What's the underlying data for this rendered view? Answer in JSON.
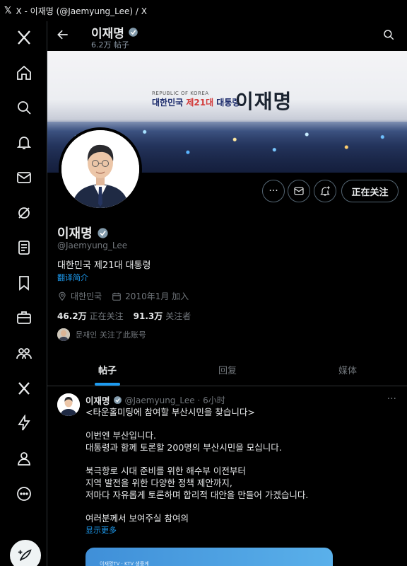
{
  "window": {
    "title": "X - 이재명 (@Jaemyung_Lee) / X",
    "app_glyph": "𝕏"
  },
  "nav": {
    "items": [
      "home",
      "explore",
      "notifications",
      "messages",
      "grok",
      "lists",
      "bookmarks",
      "jobs",
      "communities",
      "premium",
      "verified-orgs",
      "profile",
      "more"
    ]
  },
  "header": {
    "name": "이재명",
    "posts_count": "6.2万 帖子"
  },
  "banner": {
    "small_text": "REPUBLIC OF KOREA",
    "subtitle_prefix": "대한민국 ",
    "subtitle_accent": "제21대",
    "subtitle_suffix": " 대통령",
    "big_text": "이재명"
  },
  "actions": {
    "follow_label": "正在关注",
    "more_label": "···"
  },
  "profile": {
    "name": "이재명",
    "handle": "@Jaemyung_Lee",
    "bio": "대한민국 제21대 대통령",
    "translate_label": "翻译简介",
    "location": "대한민국",
    "joined": "2010年1月 加入",
    "following_count": "46.2万",
    "following_label": "正在关注",
    "followers_count": "91.3万",
    "followers_label": "关注者",
    "followed_by": "문재인 关注了此账号"
  },
  "tabs": [
    {
      "label": "帖子",
      "active": true
    },
    {
      "label": "回复",
      "active": false
    },
    {
      "label": "媒体",
      "active": false
    }
  ],
  "post": {
    "name": "이재명",
    "meta": "@Jaemyung_Lee · 6小时",
    "more": "···",
    "lines": [
      "<타운홀미팅에 참여할 부산시민을 찾습니다>",
      "",
      "이번엔 부산입니다.",
      "대통령과 함께 토론할 200명의 부산시민을 모십니다.",
      "",
      "북극항로 시대 준비를 위한 해수부 이전부터",
      "지역 발전을 위한 다양한 정책 제안까지,",
      "저마다 자유롭게 토론하며 합리적 대안을 만들어 가겠습니다.",
      "",
      "여러분께서 보여주실 참여의"
    ],
    "show_more": "显示更多",
    "media_caption": "이재명TV · KTV 생중계"
  },
  "colors": {
    "accent": "#1d9bf0",
    "background": "#000000",
    "text": "#e7e9ea",
    "muted": "#71767b"
  }
}
